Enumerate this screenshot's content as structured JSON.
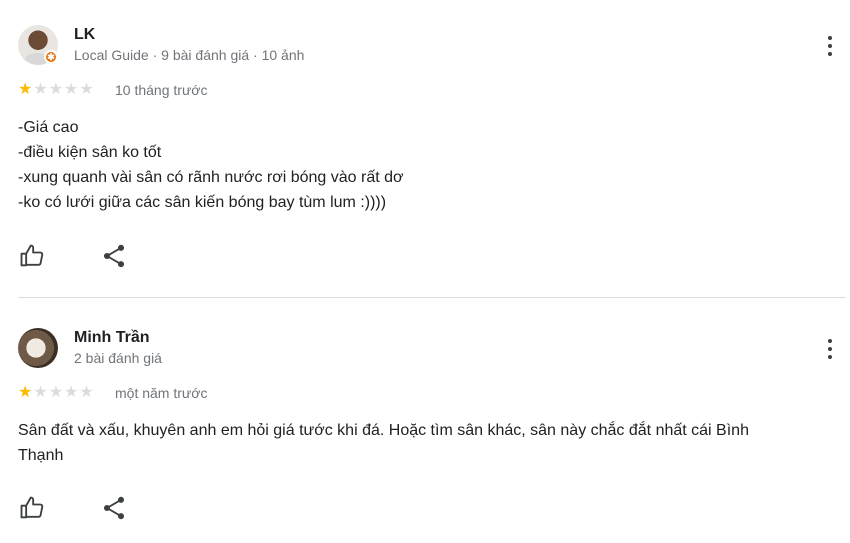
{
  "reviews": [
    {
      "name": "LK",
      "meta": "Local Guide · 9 bài đánh giá · 10 ảnh",
      "rating": 1,
      "time": "10 tháng trước",
      "lines": [
        "-Giá cao",
        "-điều kiện sân ko tốt",
        "-xung quanh vài sân có rãnh nước rơi bóng vào rất dơ",
        "-ko có lưới giữa các sân kiến bóng bay tùm lum :))))"
      ],
      "local_guide": true
    },
    {
      "name": "Minh Trần",
      "meta": "2 bài đánh giá",
      "rating": 1,
      "time": "một năm trước",
      "lines": [
        "Sân đất và xấu, khuyên anh em hỏi giá tước khi đá. Hoặc tìm sân khác, sân này chắc đắt nhất cái Bình",
        "Thạnh"
      ],
      "local_guide": false
    }
  ],
  "icons": {
    "like": "thumb-up-icon",
    "share": "share-icon",
    "more": "more-vert-icon",
    "star": "star-icon"
  },
  "colors": {
    "star_filled": "#fbbc04",
    "star_empty": "#dadce0",
    "meta_text": "#70757a",
    "guide_badge": "#e8710a"
  }
}
